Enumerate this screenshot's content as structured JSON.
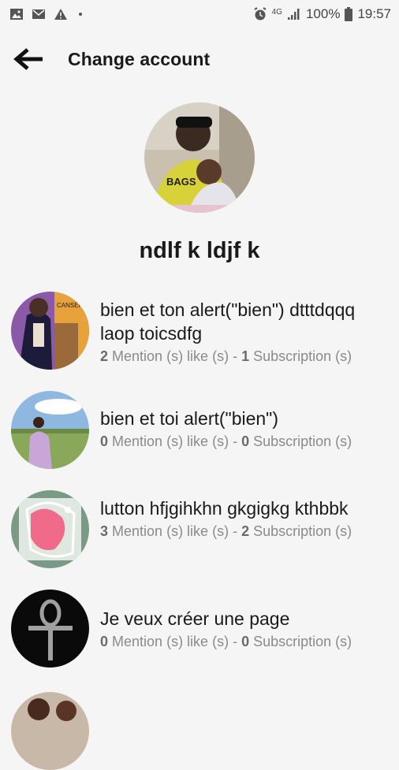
{
  "status_bar": {
    "battery_percent": "100%",
    "time": "19:57",
    "network": "4G",
    "icons": [
      "image-icon",
      "mail-icon",
      "warning-icon",
      "alarm-icon",
      "signal-icon",
      "battery-icon"
    ]
  },
  "header": {
    "title": "Change account"
  },
  "profile": {
    "name": "ndlf k ldjf k"
  },
  "accounts": [
    {
      "name": "bien et ton alert(\"bien\") dtttdqqq laop toicsdfg",
      "mentions": "2",
      "mentions_label": "Mention (s) like (s)",
      "separator": " - ",
      "subscriptions": "1",
      "subscriptions_label": "Subscription (s)"
    },
    {
      "name": "bien et toi  alert(\"bien\")",
      "mentions": "0",
      "mentions_label": "Mention (s) like (s)",
      "separator": " - ",
      "subscriptions": "0",
      "subscriptions_label": "Subscription (s)"
    },
    {
      "name": "lutton hfjgihkhn gkgigkg kthbbk",
      "mentions": "3",
      "mentions_label": "Mention (s) like (s)",
      "separator": " - ",
      "subscriptions": "2",
      "subscriptions_label": "Subscription (s)"
    },
    {
      "name": "Je veux créer une page",
      "mentions": "0",
      "mentions_label": "Mention (s) like (s)",
      "separator": " - ",
      "subscriptions": "0",
      "subscriptions_label": "Subscription (s)"
    }
  ]
}
